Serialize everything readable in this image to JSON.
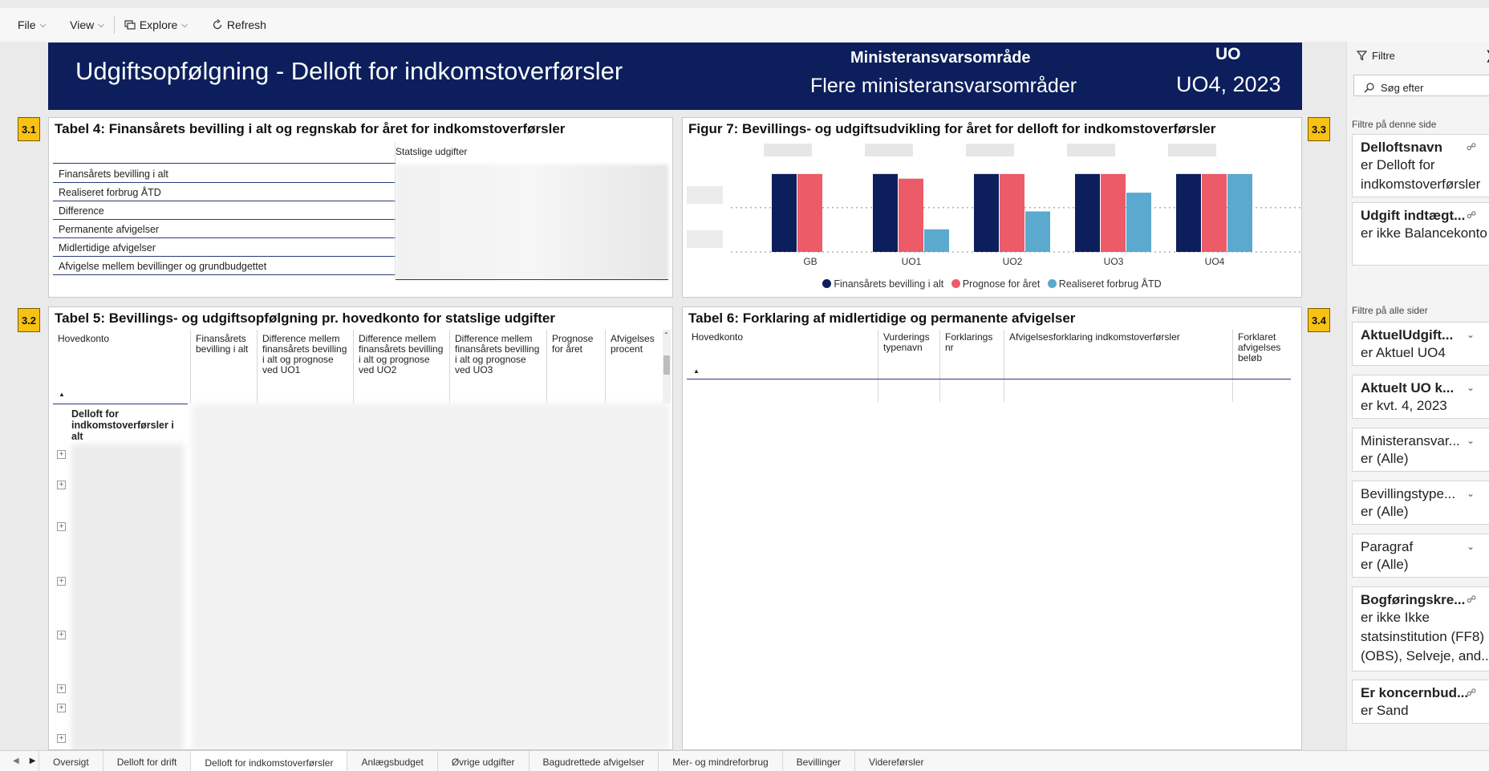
{
  "toolbar": {
    "file": "File",
    "view": "View",
    "explore": "Explore",
    "refresh": "Refresh"
  },
  "header": {
    "title": "Udgiftsopfølgning - Delloft for indkomstoverførsler",
    "minister_label": "Ministeransvarsområde",
    "minister_value": "Flere ministeransvarsområder",
    "uo_label": "UO",
    "uo_value": "UO4, 2023"
  },
  "badges": [
    "3.1",
    "3.2",
    "3.3",
    "3.4"
  ],
  "table4": {
    "title": "Tabel 4: Finansårets bevilling i alt og regnskab for året for indkomstoverførsler",
    "column": "Statslige udgifter",
    "rows": [
      "Finansårets bevilling i alt",
      "Realiseret forbrug ÅTD",
      "Difference",
      "Permanente afvigelser",
      "Midlertidige afvigelser",
      "Afvigelse mellem bevillinger og grundbudgettet"
    ]
  },
  "figure7": {
    "title": "Figur 7: Bevillings- og udgiftsudvikling for året for delloft for indkomstoverførsler",
    "legend": [
      {
        "name": "Finansårets bevilling i alt",
        "color": "#0c1f5c"
      },
      {
        "name": "Prognose for året",
        "color": "#ec5b68"
      },
      {
        "name": "Realiseret forbrug ÅTD",
        "color": "#5ba9cf"
      }
    ]
  },
  "chart_data": {
    "type": "bar",
    "title": "Figur 7: Bevillings- og udgiftsudvikling for året for delloft for indkomstoverførsler",
    "categories": [
      "GB",
      "UO1",
      "UO2",
      "UO3",
      "UO4"
    ],
    "series": [
      {
        "name": "Finansårets bevilling i alt",
        "values": [
          1.0,
          1.0,
          1.0,
          1.0,
          1.0
        ]
      },
      {
        "name": "Prognose for året",
        "values": [
          1.0,
          0.94,
          1.0,
          1.0,
          1.0
        ]
      },
      {
        "name": "Realiseret forbrug ÅTD",
        "values": [
          null,
          0.29,
          0.52,
          0.76,
          1.0
        ]
      }
    ],
    "ylim": [
      0,
      1.05
    ],
    "grid": true,
    "legend_position": "bottom"
  },
  "table5": {
    "title": "Tabel 5: Bevillings- og udgiftsopfølgning pr. hovedkonto for statslige udgifter",
    "columns": [
      "Hovedkonto",
      "Finansårets bevilling i alt",
      "Difference mellem finansårets bevilling i alt og prognose ved UO1",
      "Difference mellem finansårets bevilling i alt og prognose ved UO2",
      "Difference mellem finansårets bevilling i alt og prognose ved UO3",
      "Prognose for året",
      "Afvigelses procent"
    ],
    "first_row": "Delloft for indkomstoverførsler i alt"
  },
  "table6": {
    "title": "Tabel 6: Forklaring af midlertidige og permanente afvigelser",
    "columns": [
      "Hovedkonto",
      "Vurderings typenavn",
      "Forklarings nr",
      "Afvigelsesforklaring indkomstoverførsler",
      "Forklaret afvigelses beløb"
    ]
  },
  "filters": {
    "header": "Filtre",
    "search_placeholder": "Søg efter",
    "section_page": "Filtre på denne side",
    "section_all": "Filtre på alle sider",
    "page_filters": [
      {
        "name": "Delloftsnavn",
        "value": "er Delloft for indkomstoverførsler",
        "bold": true
      },
      {
        "name": "Udgift indtægt...",
        "value": "er ikke Balancekonto",
        "bold": true
      }
    ],
    "all_filters": [
      {
        "name": "AktuelUdgift...",
        "value": "er Aktuel UO4",
        "bold": true
      },
      {
        "name": "Aktuelt UO k...",
        "value": "er kvt. 4, 2023",
        "bold": true
      },
      {
        "name": "Ministeransvar...",
        "value": "er (Alle)",
        "bold": false
      },
      {
        "name": "Bevillingstype...",
        "value": "er (Alle)",
        "bold": false
      },
      {
        "name": "Paragraf",
        "value": "er (Alle)",
        "bold": false
      },
      {
        "name": "Bogføringskre...",
        "value": "er ikke Ikke statsinstitution (FF8) (OBS), Selveje, and...",
        "bold": true
      },
      {
        "name": "Er koncernbud...",
        "value": "er Sand",
        "bold": true
      }
    ]
  },
  "tabs": [
    "Oversigt",
    "Delloft for drift",
    "Delloft for indkomstoverførsler",
    "Anlægsbudget",
    "Øvrige udgifter",
    "Bagudrettede afvigelser",
    "Mer- og mindreforbrug",
    "Bevillinger",
    "Videreførsler"
  ],
  "active_tab": "Delloft for indkomstoverførsler"
}
